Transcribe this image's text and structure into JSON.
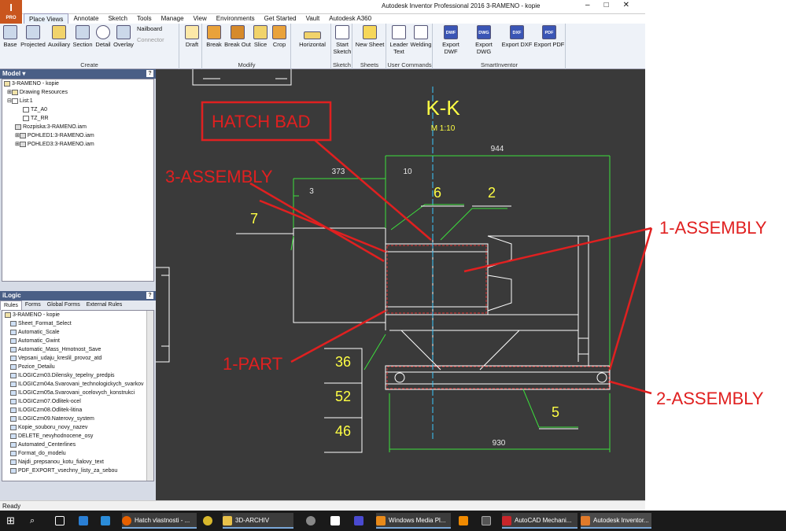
{
  "app": {
    "logo": "I",
    "logo_sub": "PRO",
    "title": "Autodesk Inventor Professional 2016   3-RAMENO - kopie",
    "window_controls": [
      "–",
      "□",
      "✕"
    ]
  },
  "menu_tabs": [
    "Place Views",
    "Annotate",
    "Sketch",
    "Tools",
    "Manage",
    "View",
    "Environments",
    "Get Started",
    "Vault",
    "Autodesk A360"
  ],
  "ribbon": {
    "create": {
      "title": "Create",
      "buttons": [
        "Base",
        "Projected",
        "Auxiliary",
        "Section",
        "Detail",
        "Overlay"
      ],
      "small": [
        "Nailboard",
        "Connector"
      ]
    },
    "draft": "Draft",
    "modify": {
      "title": "Modify",
      "buttons": [
        "Break",
        "Break Out",
        "Slice",
        "Crop"
      ]
    },
    "horizontal": "Horizontal",
    "sketch": {
      "title": "Sketch",
      "button": "Start Sketch"
    },
    "sheets": {
      "title": "Sheets",
      "button": "New Sheet"
    },
    "user_commands": {
      "title": "User Commands",
      "buttons": [
        "Leader Text",
        "Welding"
      ]
    },
    "smartinventor": {
      "title": "SmartInventor",
      "buttons": [
        "Export DWF",
        "Export DWG",
        "Export DXF",
        "Export PDF"
      ],
      "icons": [
        "DWF",
        "DWG",
        "DXF",
        "PDF"
      ]
    }
  },
  "model_panel": {
    "title": "Model ▾",
    "help": "?",
    "tree": [
      {
        "label": "3-RAMENO - kopie",
        "indent": 0
      },
      {
        "label": "Drawing Resources",
        "indent": 1
      },
      {
        "label": "List:1",
        "indent": 1
      },
      {
        "label": "TZ_A0",
        "indent": 2
      },
      {
        "label": "TZ_RR",
        "indent": 2
      },
      {
        "label": "Rozpiska:3-RAMENO.iam",
        "indent": 2
      },
      {
        "label": "POHLED1:3-RAMENO.iam",
        "indent": 2
      },
      {
        "label": "POHLED3:3-RAMENO.iam",
        "indent": 2
      }
    ]
  },
  "ilogic_panel": {
    "title": "iLogic",
    "help": "?",
    "tabs": [
      "Rules",
      "Forms",
      "Global Forms",
      "External Rules"
    ],
    "root": "3-RAMENO - kopie",
    "rules": [
      "Sheet_Format_Select",
      "Automatic_Scale",
      "Automatic_Gwint",
      "Automatic_Mass_Hmotnost_Save",
      "Vepsani_udaju_kreslil_provoz_atd",
      "Pozice_Detailu",
      "ILOGICzm03.Dilensky_tepelny_predpis",
      "ILOGICzm04a.Svarovani_technologickych_svarkov",
      "ILOGICzm05a.Svarovani_ocelovych_konstrukci",
      "ILOGICzm07.Odlitek-ocel",
      "ILOGICzm08.Odlitek-litina",
      "ILOGICzm09.Naterovy_system",
      "Kopie_souboru_novy_nazev",
      "DELETE_nevyhodnocene_osy",
      "Automated_Centerlines",
      "Format_do_modelu",
      "Najdi_prepsanou_kotu_fialovy_text",
      "PDF_EXPORT_vsechny_listy_za_sebou"
    ]
  },
  "drawing": {
    "section_title": "K-K",
    "scale": "M 1:10",
    "dimensions": [
      "944",
      "373",
      "10",
      "3",
      "930"
    ],
    "balloons": [
      "7",
      "6",
      "2",
      "5"
    ],
    "table_values": [
      "36",
      "52",
      "46"
    ]
  },
  "annotations": [
    "HATCH BAD",
    "3-ASSEMBLY",
    "1-ASSEMBLY",
    "1-PART",
    "2-ASSEMBLY"
  ],
  "status": "Ready",
  "taskbar": {
    "items": [
      "Hatch vlastnosti - ...",
      "3D-ARCHIV",
      "Windows Media Pl...",
      "AutoCAD Mechani...",
      "Autodesk Inventor..."
    ]
  },
  "colors": {
    "annotation": "#e02020",
    "drawing_line": "#ffffff",
    "dimension": "#00ff00",
    "drawing_text": "#ffff00",
    "canvas_bg": "#3a3a3a"
  }
}
